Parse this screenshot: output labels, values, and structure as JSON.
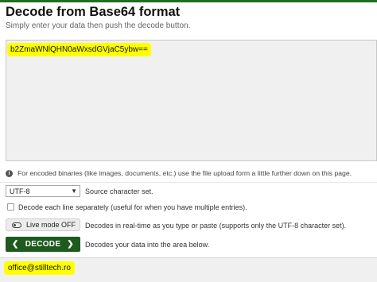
{
  "header": {
    "title": "Decode from Base64 format",
    "subtitle": "Simply enter your data then push the decode button."
  },
  "input": {
    "value": "b2ZmaWNlQHN0aWxsdGVjaC5ybw=="
  },
  "info": {
    "icon": "info-icon",
    "text": "For encoded binaries (like images, documents, etc.) use the file upload form a little further down on this page."
  },
  "options": {
    "charset_value": "UTF-8",
    "charset_label": "Source character set.",
    "each_line_label": "Decode each line separately (useful for when you have multiple entries).",
    "each_line_checked": false,
    "live_mode_label": "Live mode OFF",
    "live_mode_desc": "Decodes in real-time as you type or paste (supports only the UTF-8 character set).",
    "decode_label": "DECODE",
    "decode_desc": "Decodes your data into the area below."
  },
  "output": {
    "value": "office@stilltech.ro"
  },
  "colors": {
    "accent": "#1e5a1e",
    "highlight": "#ffff00",
    "textarea_bg": "#f0f0f0"
  }
}
